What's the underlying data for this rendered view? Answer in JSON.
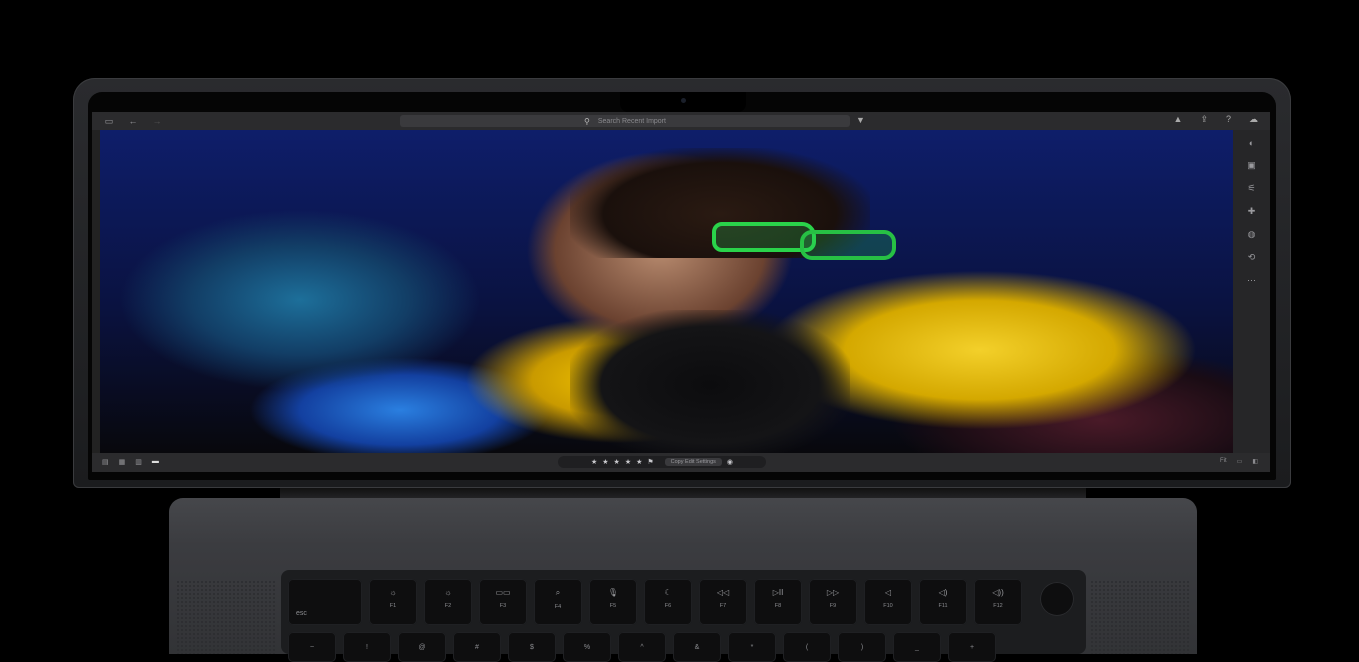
{
  "app": {
    "search_placeholder": "Search Recent Import"
  },
  "toolbar": {
    "left_icons": [
      "sidebar-icon",
      "back-arrow-icon",
      "forward-arrow-icon"
    ],
    "right_icons": [
      "bell-icon",
      "share-icon",
      "help-icon",
      "cloud-icon"
    ]
  },
  "rightpanel": {
    "icons": [
      "adjust-icon",
      "crop-icon",
      "sliders-icon",
      "heal-icon",
      "mask-icon",
      "history-icon",
      "more-icon"
    ]
  },
  "bottombar": {
    "view_icons": [
      "grid-icon",
      "square-grid-icon",
      "compare-icon",
      "detail-icon"
    ],
    "rating_stars": 5,
    "copy_button": "Copy Edit Settings",
    "zoom": "Fit"
  },
  "keyboard": {
    "row1": [
      {
        "label": "esc",
        "icon": ""
      },
      {
        "label": "F1",
        "icon": "☼"
      },
      {
        "label": "F2",
        "icon": "☼"
      },
      {
        "label": "F3",
        "icon": "▭▭"
      },
      {
        "label": "F4",
        "icon": "⌕"
      },
      {
        "label": "F5",
        "icon": "🎙"
      },
      {
        "label": "F6",
        "icon": "☾"
      },
      {
        "label": "F7",
        "icon": "◁◁"
      },
      {
        "label": "F8",
        "icon": "▷II"
      },
      {
        "label": "F9",
        "icon": "▷▷"
      },
      {
        "label": "F10",
        "icon": "◁"
      },
      {
        "label": "F11",
        "icon": "◁)"
      },
      {
        "label": "F12",
        "icon": "◁))"
      }
    ],
    "row2": [
      "~",
      "!",
      "@",
      "#",
      "$",
      "%",
      "^",
      "&",
      "*",
      "(",
      ")",
      "_",
      "+"
    ]
  }
}
